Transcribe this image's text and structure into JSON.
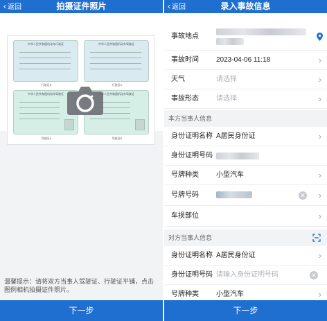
{
  "left": {
    "nav": {
      "back": "返回",
      "title": "拍摄证件照片"
    },
    "sample": {
      "card1_title": "中华人民共和国机动车行驶证",
      "card2_title": "中华人民共和国机动车驾驶证",
      "card3_title": "中华人民共和国机动车驾驶证",
      "card4_title": "中华人民共和国机动车驾驶证",
      "caption_left_top": "行驶证B",
      "caption_right_top": "行驶证A",
      "caption_left_bottom": "驾驶证A",
      "caption_right_bottom": "驾驶证B"
    },
    "hint": "温馨提示：请将双方当事人驾驶证、行驶证平铺，点击图例相机拍摄证件照片。",
    "next": "下一步"
  },
  "right": {
    "nav": {
      "back": "返回",
      "title": "录入事故信息"
    },
    "rows": {
      "location_label": "事故地点",
      "time_label": "事故时间",
      "time_value": "2023-04-06 11:18",
      "weather_label": "天气",
      "weather_placeholder": "请选择",
      "form_label": "事故形态",
      "form_placeholder": "请选择"
    },
    "self_section": "本方当事人信息",
    "self": {
      "id_name_label": "身份证明名称",
      "id_name_value": "A居民身份证",
      "id_no_label": "身份证明号码",
      "plate_type_label": "号牌种类",
      "plate_type_value": "小型汽车",
      "plate_no_label": "号牌号码",
      "damage_label": "车损部位"
    },
    "other_section": "对方当事人信息",
    "other": {
      "id_name_label": "身份证明名称",
      "id_name_value": "A居民身份证",
      "id_no_label": "身份证明号码",
      "id_no_placeholder": "请输入身份证明号码",
      "plate_type_label": "号牌种类",
      "plate_type_value": "小型汽车"
    },
    "next": "下一步"
  },
  "colors": {
    "brand": "#1f6fd1",
    "section_bg": "#f2f3f5"
  }
}
